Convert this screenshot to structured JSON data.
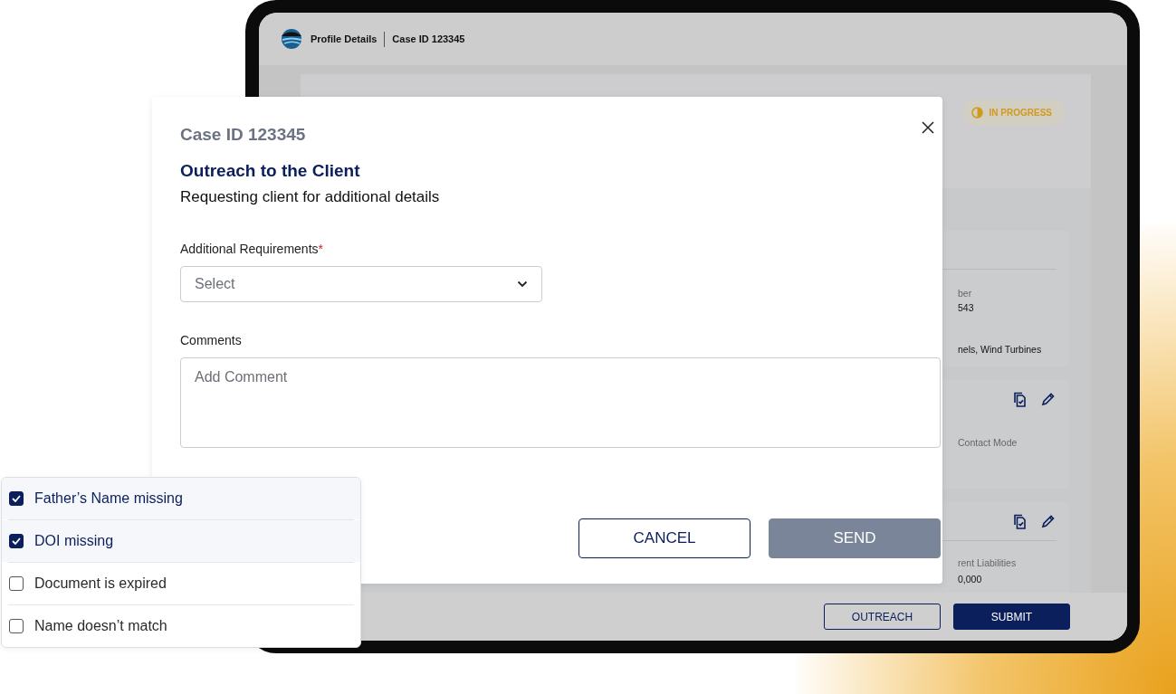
{
  "app": {
    "header": {
      "title": "Profile Details",
      "case_id": "Case ID 123345"
    },
    "status_badge": {
      "label": "IN PROGRESS"
    },
    "cards": [
      {
        "actions": false,
        "divider": true,
        "fields": [
          {
            "label": "ber",
            "value": "543"
          },
          {
            "value": "nels, Wind Turbines"
          }
        ]
      },
      {
        "actions": true,
        "divider": false,
        "fields": [
          {
            "label": "Contact Mode"
          }
        ]
      },
      {
        "actions": true,
        "divider": true,
        "fields": [
          {
            "label": "rent Liabilities",
            "value": "0,000"
          }
        ]
      }
    ],
    "footer_buttons": [
      {
        "label": "OUTREACH",
        "kind": "outline"
      },
      {
        "label": "SUBMIT",
        "kind": "primary"
      }
    ]
  },
  "modal": {
    "case_id": "Case ID 123345",
    "title": "Outreach to the Client",
    "subtitle": "Requesting client for additional details",
    "fields": [
      {
        "kind": "select",
        "label": "Additional Requirements",
        "required_mark": "*",
        "placeholder": "Select"
      },
      {
        "kind": "textarea",
        "label": "Comments",
        "placeholder": "Add Comment"
      }
    ],
    "buttons": [
      {
        "label": "CANCEL",
        "kind": "outline",
        "disabled": false
      },
      {
        "label": "SEND",
        "kind": "primary",
        "disabled": true
      }
    ]
  },
  "dropdown": {
    "options": [
      {
        "label": "Father’s Name missing",
        "checked": true
      },
      {
        "label": "DOI missing",
        "checked": true
      },
      {
        "label": "Document is expired",
        "checked": false
      },
      {
        "label": "Name doesn’t match",
        "checked": false
      }
    ]
  }
}
